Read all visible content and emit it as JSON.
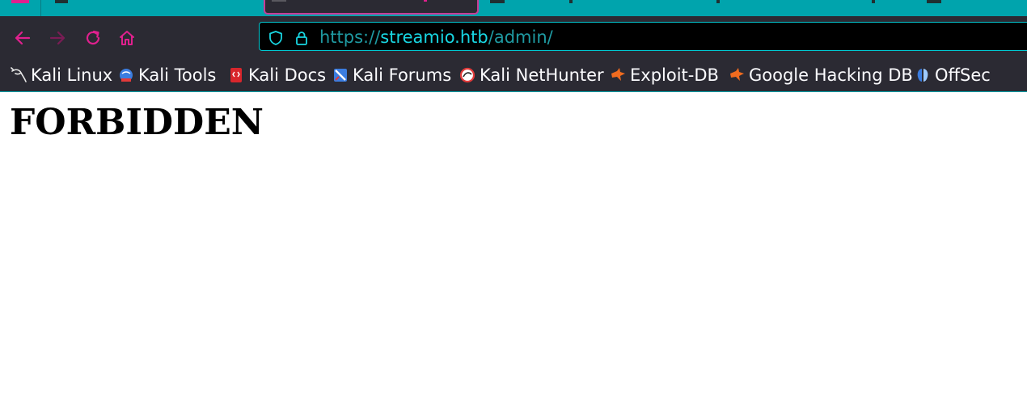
{
  "browser": {
    "colors": {
      "accent": "#e0208e",
      "tabstrip": "#00a4ad",
      "toolbar": "#2b2a33",
      "url_host": "#18d6e2"
    },
    "nav": {
      "back_icon": "arrow-left-icon",
      "forward_icon": "arrow-right-icon",
      "reload_icon": "reload-icon",
      "home_icon": "home-icon"
    },
    "url": {
      "scheme": "https://",
      "host": "streamio.htb",
      "path": "/admin/",
      "shield_icon": "tracking-protection-shield-icon",
      "lock_icon": "padlock-icon"
    },
    "bookmarks": [
      {
        "label": "Kali Linux",
        "icon": "kali-dragon-icon"
      },
      {
        "label": "Kali Tools",
        "icon": "kali-tools-icon"
      },
      {
        "label": "Kali Docs",
        "icon": "kali-docs-icon"
      },
      {
        "label": "Kali Forums",
        "icon": "kali-forums-icon"
      },
      {
        "label": "Kali NetHunter",
        "icon": "kali-nethunter-icon"
      },
      {
        "label": "Exploit-DB",
        "icon": "exploit-db-icon"
      },
      {
        "label": "Google Hacking DB",
        "icon": "exploit-db-icon"
      },
      {
        "label": "OffSec",
        "icon": "offsec-icon"
      }
    ]
  },
  "page": {
    "heading": "FORBIDDEN"
  }
}
